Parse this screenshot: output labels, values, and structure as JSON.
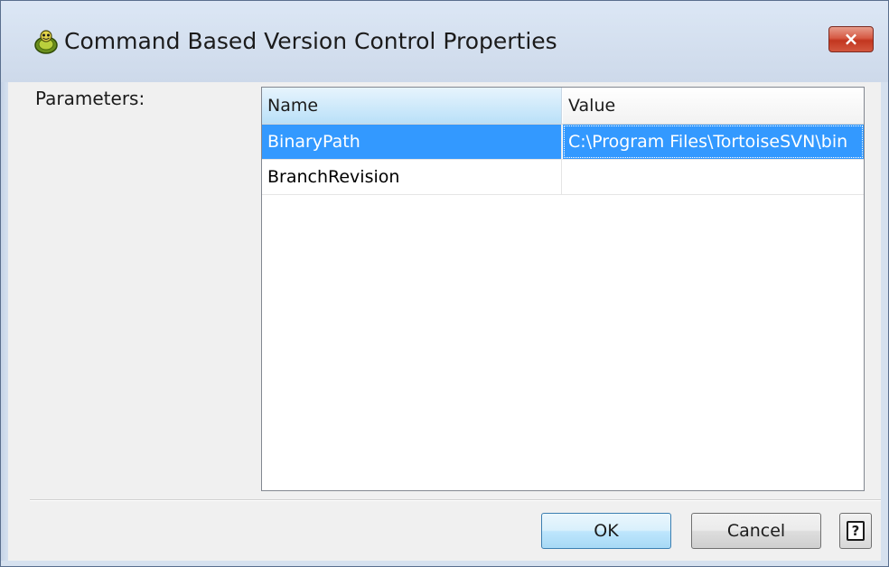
{
  "window": {
    "title": "Command Based Version Control Properties",
    "close_label": "×",
    "app_icon": "tortoise-icon"
  },
  "form": {
    "parameters_label": "Parameters:"
  },
  "grid": {
    "columns": [
      "Name",
      "Value"
    ],
    "rows": [
      {
        "name": "BinaryPath",
        "value": "C:\\Program Files\\TortoiseSVN\\bin",
        "selected": true
      },
      {
        "name": "BranchRevision",
        "value": "",
        "selected": false
      }
    ]
  },
  "buttons": {
    "ok_label": "OK",
    "cancel_label": "Cancel",
    "help_label": "?"
  },
  "colors": {
    "selection": "#3399ff",
    "header_selected": "#b9e0f8",
    "close_button": "#c2361f"
  }
}
